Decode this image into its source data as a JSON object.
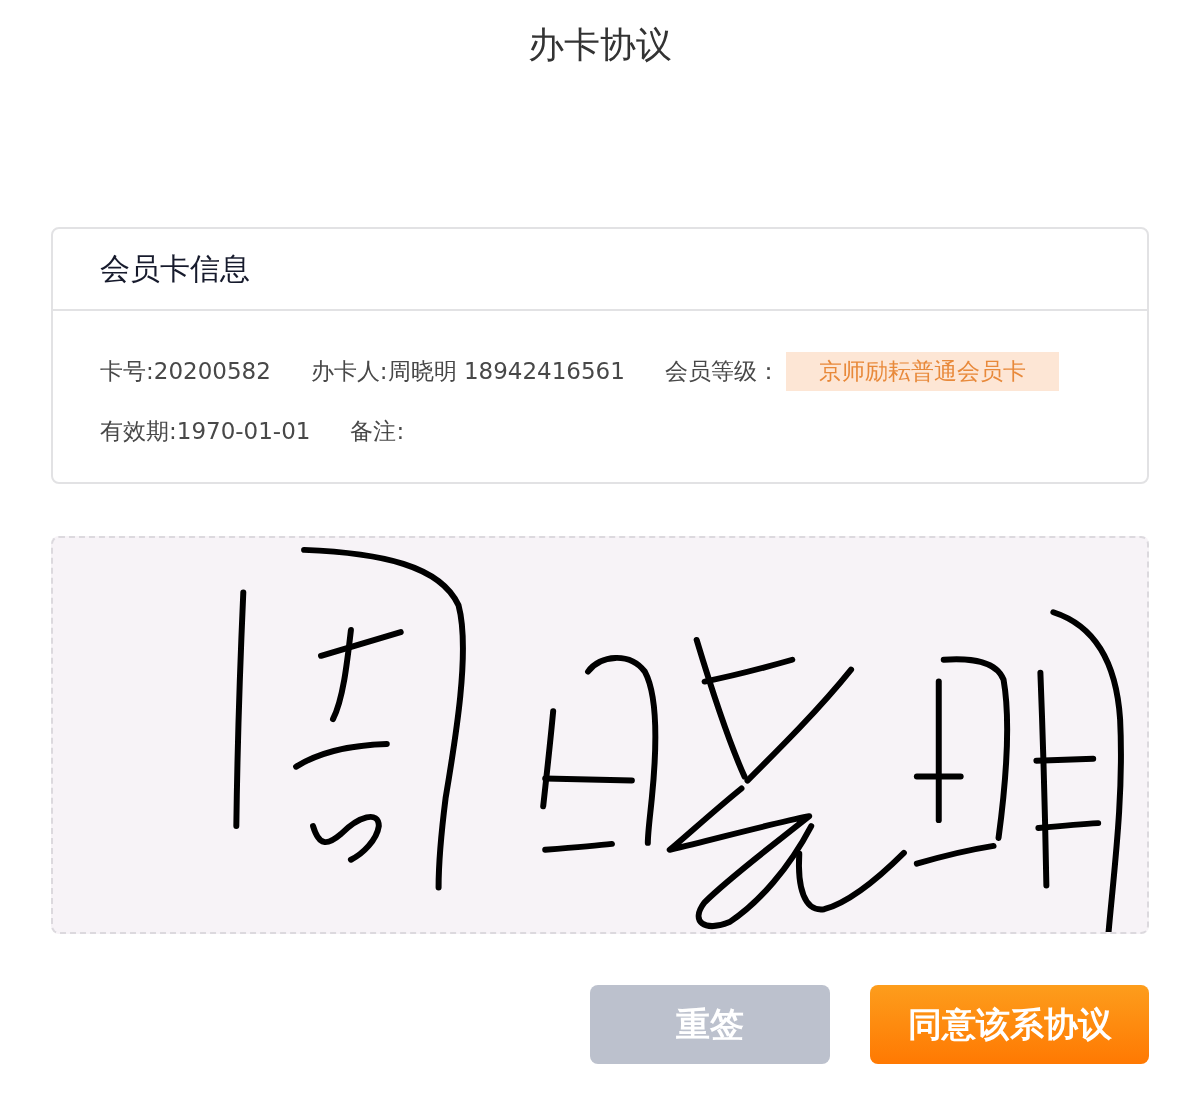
{
  "page": {
    "title": "办卡协议"
  },
  "card": {
    "title": "会员卡信息",
    "rows": [
      [
        {
          "kind": "text",
          "text": "卡号:20200582"
        },
        {
          "kind": "text",
          "text": "办卡人:周晓明 18942416561"
        },
        {
          "kind": "badge",
          "label": "会员等级：",
          "value": "京师励耘普通会员卡"
        }
      ],
      [
        {
          "kind": "text",
          "text": "有效期:1970-01-01"
        },
        {
          "kind": "text",
          "text": "备注:"
        }
      ]
    ]
  },
  "signature_pad": {
    "signed": true
  },
  "buttons": [
    {
      "kind": "secondary",
      "label": "重签"
    },
    {
      "kind": "primary",
      "label": "同意该系协议"
    }
  ]
}
